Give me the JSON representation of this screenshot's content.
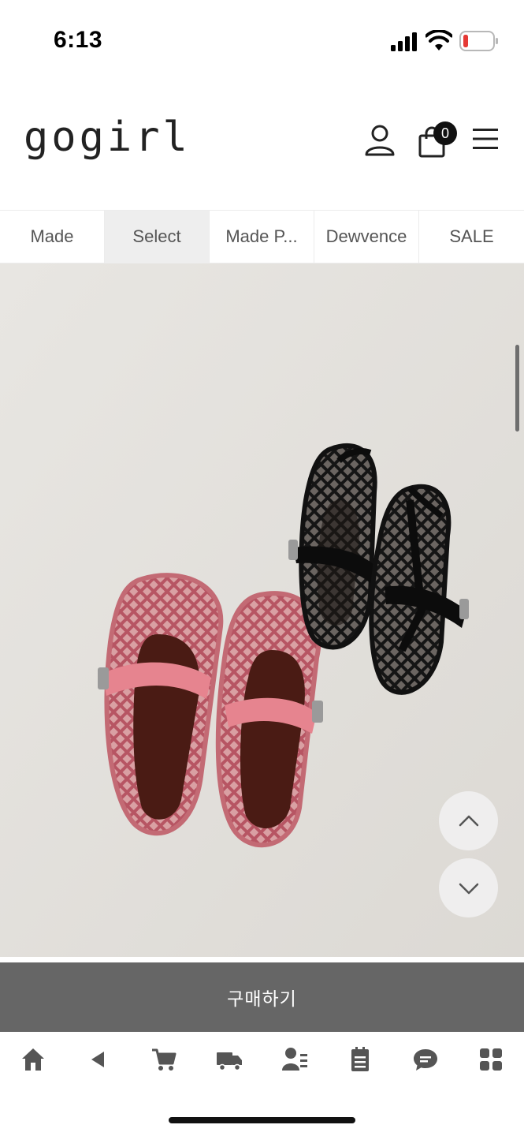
{
  "status_bar": {
    "time": "6:13",
    "icons": [
      "signal-icon",
      "wifi-icon",
      "battery-icon"
    ],
    "battery_color": "#e53935"
  },
  "header": {
    "logo": "gogirl",
    "cart_count": "0",
    "icons": [
      "user-icon",
      "shopping-bag-icon",
      "menu-icon"
    ]
  },
  "tabs": [
    {
      "label": "Made"
    },
    {
      "label": "Select"
    },
    {
      "label": "Made P..."
    },
    {
      "label": "Dewvence"
    },
    {
      "label": "SALE"
    }
  ],
  "active_tab": "Select",
  "product": {
    "image_description_icons": [
      "pink-mesh-shoes",
      "black-mesh-sandals"
    ],
    "scroll_up_icon": "chevron-up-icon",
    "scroll_down_icon": "chevron-down-icon"
  },
  "buy_button": {
    "label": "구매하기",
    "color": "#666666"
  },
  "bottom_bar": {
    "icons": [
      "home-icon",
      "back-icon",
      "cart-icon",
      "delivery-truck-icon",
      "member-icon",
      "order-list-icon",
      "chat-icon",
      "grid-menu-icon"
    ],
    "icon_color": "#555555"
  }
}
